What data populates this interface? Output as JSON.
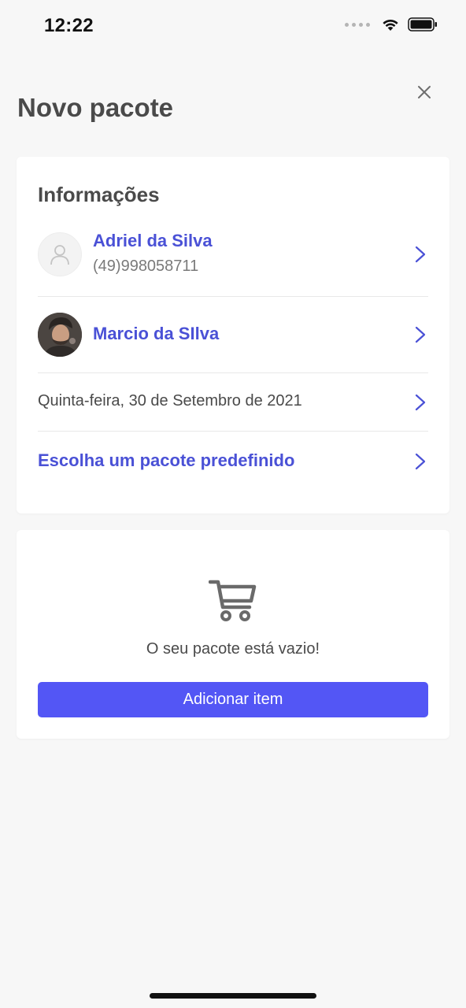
{
  "status_bar": {
    "time": "12:22"
  },
  "header": {
    "title": "Novo pacote",
    "close_icon": "close-icon"
  },
  "info_card": {
    "section_title": "Informações",
    "client": {
      "name": "Adriel da Silva",
      "phone": "(49)998058711",
      "avatar_icon": "user-icon"
    },
    "professional": {
      "name": "Marcio da SIlva",
      "avatar": "profile-photo"
    },
    "date": {
      "text": "Quinta-feira, 30 de Setembro de 2021"
    },
    "predefined_package": {
      "label": "Escolha um pacote predefinido"
    },
    "chevron_icon": "chevron-right-icon"
  },
  "package_card": {
    "cart_icon": "cart-icon",
    "empty_message": "O seu pacote está vazio!",
    "add_button_label": "Adicionar item"
  },
  "colors": {
    "accent": "#4a51d6",
    "button": "#5356f5",
    "background": "#f7f7f7",
    "card": "#ffffff",
    "text": "#4a4a4a",
    "muted": "#7a7a7a"
  }
}
